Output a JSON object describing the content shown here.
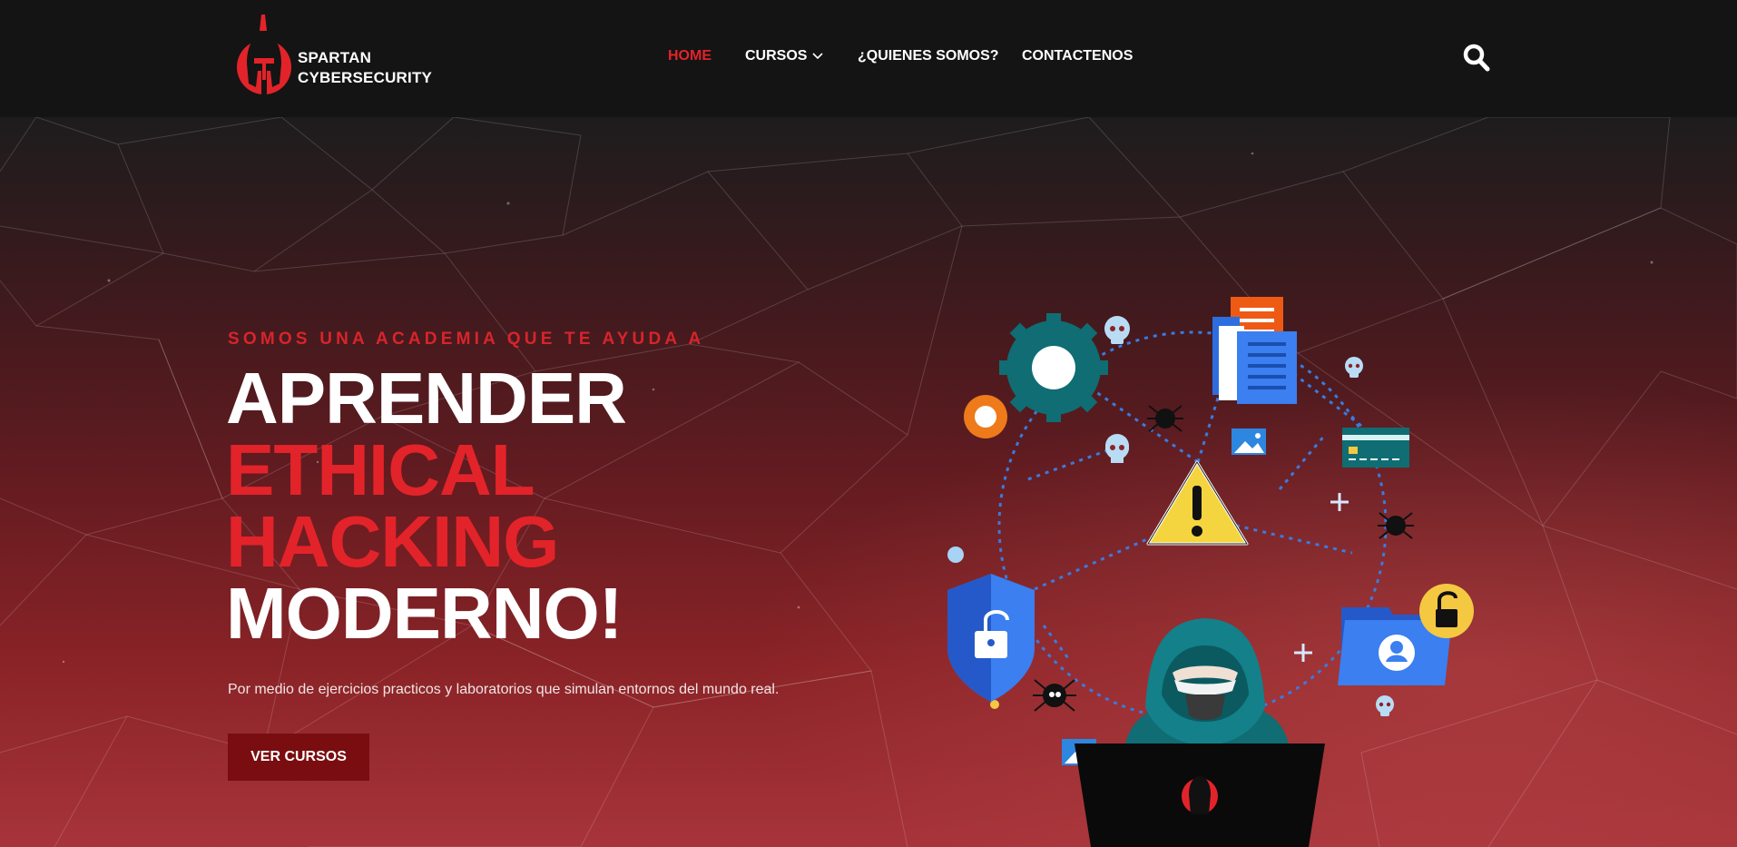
{
  "brand": {
    "line1": "SPARTAN",
    "line2": "CYBERSECURITY",
    "accent_color": "#e3232a"
  },
  "nav": {
    "items": [
      {
        "label": "HOME",
        "active": true
      },
      {
        "label": "CURSOS",
        "has_dropdown": true
      },
      {
        "label": "¿QUIENES SOMOS?"
      },
      {
        "label": "CONTACTENOS"
      }
    ],
    "search_icon": "search-icon"
  },
  "hero": {
    "eyebrow": "SOMOS UNA ACADEMIA QUE TE AYUDA A",
    "headline": {
      "line1": "APRENDER",
      "line2": "ETHICAL",
      "line3": "HACKING",
      "line4": "MODERNO!"
    },
    "subtitle": "Por medio de ejercicios practicos y laboratorios que simulan entornos del mundo real.",
    "cta_label": "VER CURSOS",
    "cta_color": "#7a0d10"
  }
}
